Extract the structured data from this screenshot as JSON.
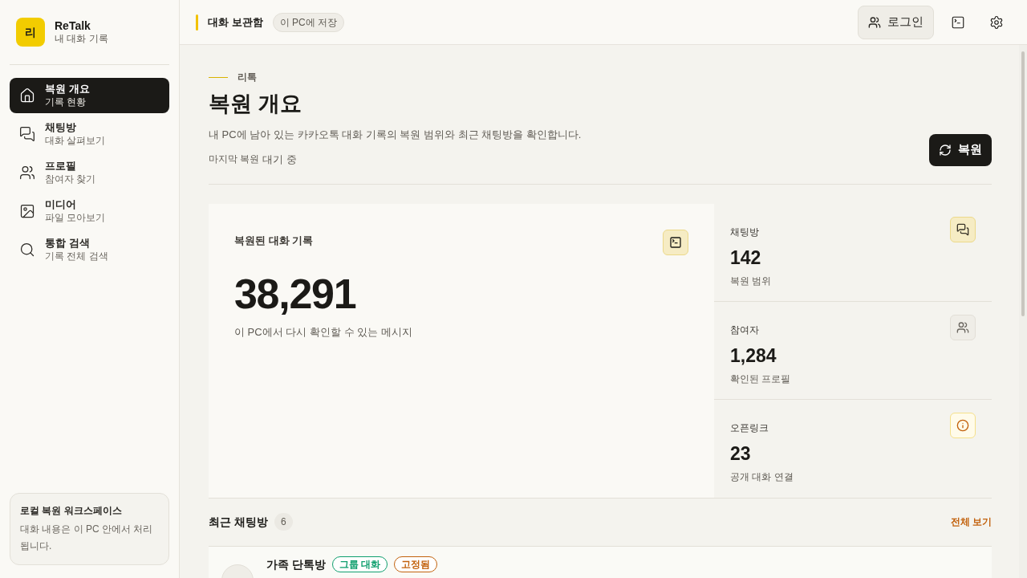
{
  "brand": {
    "logo": "리",
    "name": "ReTalk",
    "subtitle": "내 대화 기록"
  },
  "nav": [
    {
      "kind": "home",
      "label": "복원 개요",
      "sub": "기록 현황",
      "selected": true
    },
    {
      "kind": "chat",
      "label": "채팅방",
      "sub": "대화 살펴보기",
      "selected": false
    },
    {
      "kind": "people",
      "label": "프로필",
      "sub": "참여자 찾기",
      "selected": false
    },
    {
      "kind": "image",
      "label": "미디어",
      "sub": "파일 모아보기",
      "selected": false
    },
    {
      "kind": "search",
      "label": "통합 검색",
      "sub": "기록 전체 검색",
      "selected": false
    }
  ],
  "workspace": {
    "title": "로컬 복원 워크스페이스",
    "text": "대화 내용은 이 PC 안에서 처리됩니다."
  },
  "header": {
    "title": "대화 보관함",
    "badge": "이 PC에 저장",
    "login": "로그인"
  },
  "page": {
    "eyebrow": "리톡",
    "title": "복원 개요",
    "description": "내 PC에 남아 있는 카카오톡 대화 기록의 복원 범위와 최근 채팅방을 확인합니다.",
    "status_label": "마지막 복원",
    "status_value": "대기 중",
    "restore_button": "복원"
  },
  "main_stat": {
    "label": "복원된 대화 기록",
    "value": "38,291",
    "caption": "이 PC에서 다시 확인할 수 있는 메시지"
  },
  "stats": [
    {
      "kind": "chat",
      "label": "채팅방",
      "value": "142",
      "caption": "복원 범위"
    },
    {
      "kind": "people",
      "label": "참여자",
      "value": "1,284",
      "caption": "확인된 프로필"
    },
    {
      "kind": "info",
      "label": "오픈링크",
      "value": "23",
      "caption": "공개 대화 연결"
    }
  ],
  "recent": {
    "title": "최근 채팅방",
    "count": "6",
    "link": "전체 보기",
    "rows": [
      {
        "name": "가족 단톡방",
        "tags": [
          {
            "label": "그룹 대화",
            "color": "#0f9f6e"
          },
          {
            "label": "고정됨",
            "color": "#c2610c"
          }
        ]
      }
    ]
  }
}
